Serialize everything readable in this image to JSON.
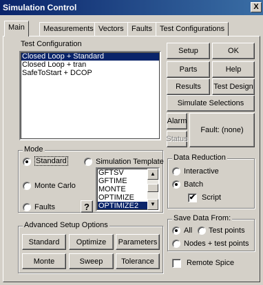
{
  "window": {
    "title": "Simulation Control",
    "close_glyph": "X"
  },
  "tabs": [
    {
      "label": "Main",
      "active": true
    },
    {
      "label": "Measurements",
      "active": false
    },
    {
      "label": "Vectors",
      "active": false
    },
    {
      "label": "Faults",
      "active": false
    },
    {
      "label": "Test Configurations",
      "active": false
    }
  ],
  "test_configuration": {
    "label": "Test Configuration",
    "items": [
      "Closed Loop + Standard",
      "Closed Loop + tran",
      "SafeToStart + DCOP"
    ],
    "selected_index": 0
  },
  "buttons": {
    "setup": "Setup",
    "ok": "OK",
    "parts": "Parts",
    "help": "Help",
    "results": "Results",
    "test_design": "Test Design",
    "simulate_selections": "Simulate Selections",
    "alarm": "Alarm",
    "status": "Status",
    "fault": "Fault: (none)"
  },
  "mode": {
    "title": "Mode",
    "standard": "Standard",
    "simulation_template": "Simulation Template",
    "monte_carlo": "Monte Carlo",
    "faults": "Faults",
    "help_glyph": "?",
    "selected": "Standard",
    "template_items": [
      "GFTSV",
      "GFTIME",
      "MONTE",
      "OPTIMIZE",
      "OPTIMIZE2"
    ],
    "template_selected_index": 4
  },
  "data_reduction": {
    "title": "Data Reduction",
    "interactive": "Interactive",
    "batch": "Batch",
    "script": "Script",
    "selected": "Batch",
    "script_checked": true
  },
  "save_data": {
    "title": "Save Data From:",
    "all": "All",
    "test_points": "Test points",
    "nodes_test_points": "Nodes + test points",
    "selected": "All"
  },
  "remote_spice": {
    "label": "Remote Spice",
    "checked": false
  },
  "advanced": {
    "title": "Advanced Setup Options",
    "standard": "Standard",
    "optimize": "Optimize",
    "parameters": "Parameters",
    "monte": "Monte",
    "sweep": "Sweep",
    "tolerance": "Tolerance"
  },
  "glyphs": {
    "check": "✔",
    "arrow_up": "▲",
    "arrow_down": "▼"
  },
  "colors": {
    "face": "#d4d0c8",
    "title_bar": "#0a246a",
    "selection": "#0a246a"
  }
}
